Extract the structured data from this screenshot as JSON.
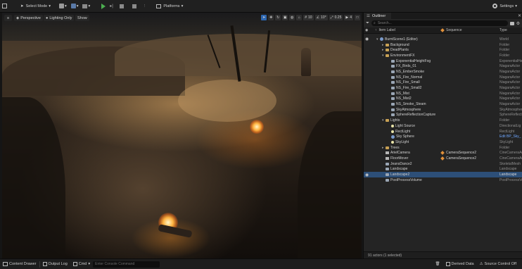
{
  "toolbar": {
    "select_mode": "Select Mode",
    "platforms": "Platforms",
    "settings": "Settings"
  },
  "viewport": {
    "perspective": "Perspective",
    "lighting": "Lighting Only",
    "show": "Show",
    "grid_value": "10",
    "angle_value": "10°",
    "scale_value": "0.25",
    "camera_speed": "4"
  },
  "outliner": {
    "tab_label": "Outliner",
    "search_placeholder": "Search...",
    "col_label": "Item Label",
    "col_sequence": "Sequence",
    "col_type": "Type",
    "footer": "91 actors (1 selected)",
    "rows": [
      {
        "label": "BurntScene1 (Editor)",
        "seq": "",
        "type": "World",
        "indent": 1,
        "icon": "world",
        "arrow": "▾"
      },
      {
        "label": "Background",
        "seq": "",
        "type": "Folder",
        "indent": 2,
        "icon": "folder",
        "arrow": "▸"
      },
      {
        "label": "DeadPlants",
        "seq": "",
        "type": "Folder",
        "indent": 2,
        "icon": "folder",
        "arrow": "▸"
      },
      {
        "label": "EnvironmentFX",
        "seq": "",
        "type": "Folder",
        "indent": 2,
        "icon": "folder",
        "arrow": "▾"
      },
      {
        "label": "ExponentialHeightFog",
        "seq": "",
        "type": "ExponentialHei",
        "indent": 3,
        "icon": "actor",
        "arrow": ""
      },
      {
        "label": "FX_Birds_01",
        "seq": "",
        "type": "NiagaraActor",
        "indent": 3,
        "icon": "actor",
        "arrow": ""
      },
      {
        "label": "NS_EmberSmoke",
        "seq": "",
        "type": "NiagaraActor",
        "indent": 3,
        "icon": "actor",
        "arrow": ""
      },
      {
        "label": "NS_Fire_Normal",
        "seq": "",
        "type": "NiagaraActor",
        "indent": 3,
        "icon": "actor",
        "arrow": ""
      },
      {
        "label": "NS_Fire_Small",
        "seq": "",
        "type": "NiagaraActor",
        "indent": 3,
        "icon": "actor",
        "arrow": ""
      },
      {
        "label": "NS_Fire_Small2",
        "seq": "",
        "type": "NiagaraActor",
        "indent": 3,
        "icon": "actor",
        "arrow": ""
      },
      {
        "label": "NS_Mist",
        "seq": "",
        "type": "NiagaraActor",
        "indent": 3,
        "icon": "actor",
        "arrow": ""
      },
      {
        "label": "NS_Mist2",
        "seq": "",
        "type": "NiagaraActor",
        "indent": 3,
        "icon": "actor",
        "arrow": ""
      },
      {
        "label": "NS_Smoke_Steam",
        "seq": "",
        "type": "NiagaraActor",
        "indent": 3,
        "icon": "actor",
        "arrow": ""
      },
      {
        "label": "SkyAtmosphere",
        "seq": "",
        "type": "SkyAtmosphere",
        "indent": 3,
        "icon": "actor",
        "arrow": ""
      },
      {
        "label": "SphereReflectionCapture",
        "seq": "",
        "type": "SphereReflecti",
        "indent": 3,
        "icon": "actor",
        "arrow": ""
      },
      {
        "label": "Lights",
        "seq": "",
        "type": "Folder",
        "indent": 2,
        "icon": "folder",
        "arrow": "▾"
      },
      {
        "label": "Light Source",
        "seq": "",
        "type": "DirectionalLig",
        "indent": 3,
        "icon": "light",
        "arrow": ""
      },
      {
        "label": "RectLight",
        "seq": "",
        "type": "RectLight",
        "indent": 3,
        "icon": "light",
        "arrow": ""
      },
      {
        "label": "Sky Sphere",
        "seq": "",
        "type": "Edit BP_Sky_",
        "indent": 3,
        "icon": "world",
        "arrow": "",
        "link": true
      },
      {
        "label": "SkyLight",
        "seq": "",
        "type": "SkyLight",
        "indent": 3,
        "icon": "light",
        "arrow": ""
      },
      {
        "label": "Trees",
        "seq": "",
        "type": "Folder",
        "indent": 2,
        "icon": "folder",
        "arrow": "▸"
      },
      {
        "label": "ArielCamera",
        "seq": "CameraSequence2",
        "type": "CineCameraAc",
        "indent": 2,
        "icon": "camera",
        "arrow": ""
      },
      {
        "label": "FloorMover",
        "seq": "CameraSequence2",
        "type": "CineCameraAc",
        "indent": 2,
        "icon": "camera",
        "arrow": ""
      },
      {
        "label": "JeansDance2",
        "seq": "",
        "type": "SkeletalMesh",
        "indent": 2,
        "icon": "actor",
        "arrow": ""
      },
      {
        "label": "Landscape",
        "seq": "",
        "type": "Landscape",
        "indent": 2,
        "icon": "actor",
        "arrow": ""
      },
      {
        "label": "Landscape2",
        "seq": "",
        "type": "Landscape",
        "indent": 2,
        "icon": "actor",
        "arrow": "",
        "selected": true,
        "eye": "👁"
      },
      {
        "label": "PostProcessVolume",
        "seq": "",
        "type": "PostProcessVo",
        "indent": 2,
        "icon": "actor",
        "arrow": ""
      }
    ]
  },
  "bottombar": {
    "content_drawer": "Content Drawer",
    "output_log": "Output Log",
    "cmd": "Cmd",
    "console_placeholder": "Enter Console Command",
    "derived_data": "Derived Data",
    "source_control": "Source Control Off"
  },
  "colors": {
    "accent": "#2d66b0",
    "selected_row": "#2d4f78",
    "folder": "#c8a154",
    "play_green": "#4caf50"
  }
}
